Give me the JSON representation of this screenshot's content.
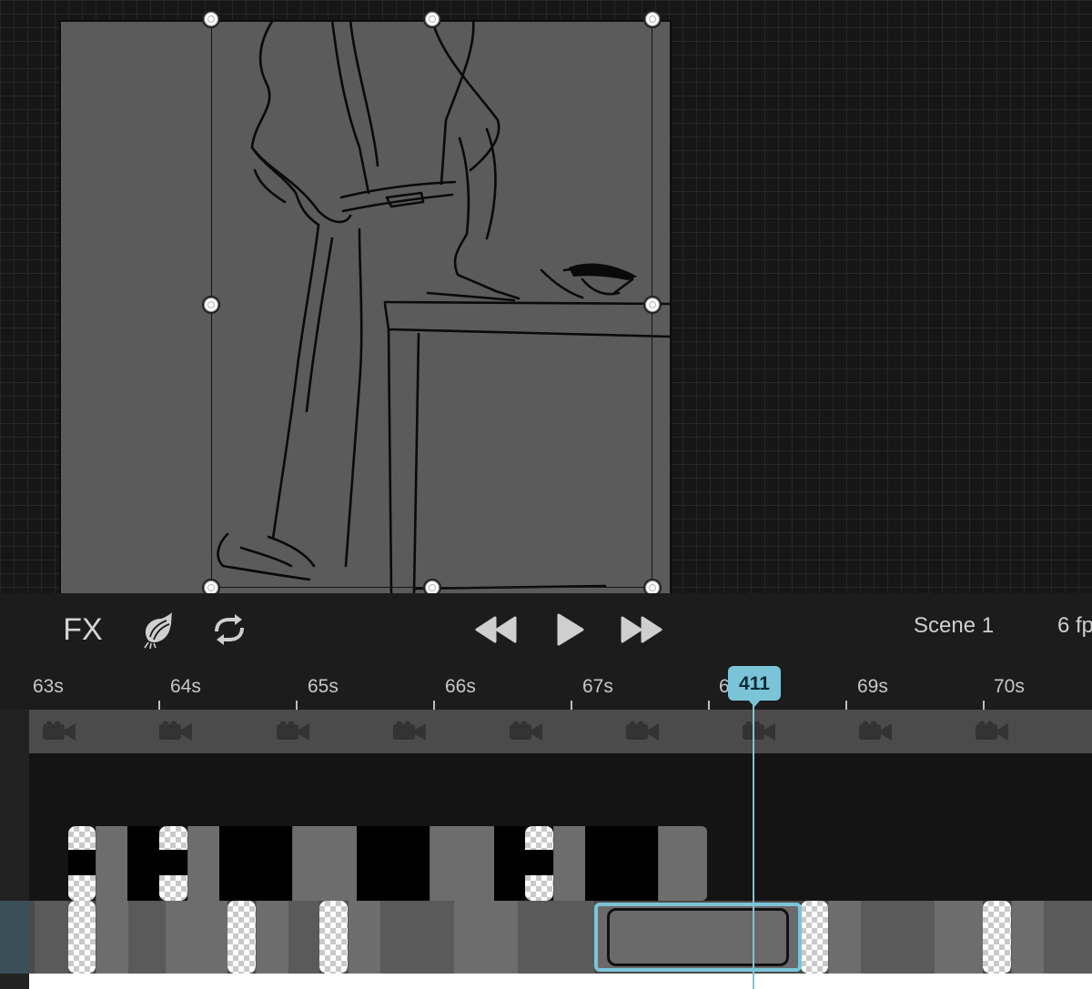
{
  "toolbar": {
    "fx_label": "FX",
    "onion_icon": "onion-skin-icon",
    "loop_icon": "loop-icon",
    "rewind_icon": "rewind-icon",
    "play_icon": "play-icon",
    "fast_forward_icon": "fast-forward-icon",
    "scene_label": "Scene 1",
    "fps_label": "6 fp"
  },
  "ruler": {
    "labels": [
      "63s",
      "64s",
      "65s",
      "66s",
      "67s",
      "6",
      "69s",
      "70s"
    ]
  },
  "playhead": {
    "frame": "411",
    "color": "#7bc4d8"
  },
  "colors": {
    "canvas_bg": "#161616",
    "artboard": "#5b5b5b",
    "accent": "#7bc4d8"
  }
}
